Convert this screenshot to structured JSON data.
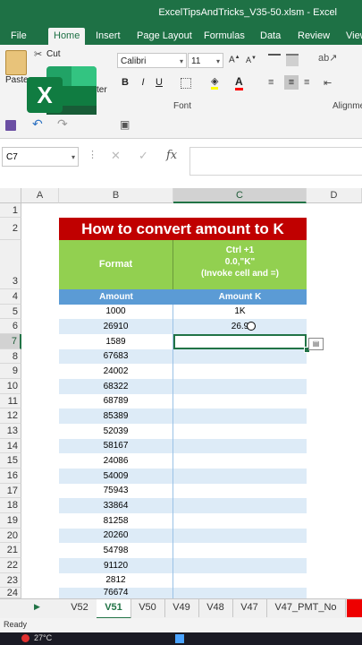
{
  "window": {
    "title": "ExcelTipsAndTricks_V35-50.xlsm - Excel"
  },
  "ribbon_tabs": [
    "File",
    "Home",
    "Insert",
    "Page Layout",
    "Formulas",
    "Data",
    "Review",
    "View"
  ],
  "ribbon": {
    "paste_label": "Paste",
    "cut_label": "Cut",
    "copy_label_partial": "ter",
    "font_name": "Calibri",
    "font_size": "11",
    "font_group_label": "Font",
    "alignment_group_label": "Alignme"
  },
  "name_box": "C7",
  "fx_symbol": "fx",
  "columns": [
    "A",
    "B",
    "C",
    "D"
  ],
  "rows": [
    "1",
    "2",
    "3",
    "4",
    "5",
    "6",
    "7",
    "8",
    "9",
    "10",
    "11",
    "12",
    "13",
    "14",
    "15",
    "16",
    "17",
    "18",
    "19",
    "20",
    "21",
    "22",
    "23",
    "24"
  ],
  "sheet": {
    "title": "How to convert amount to K",
    "format_label": "Format",
    "format_desc_line1": "Ctrl +1",
    "format_desc_line2": "0.0,\"K\"",
    "format_desc_line3": "(Invoke cell and =)",
    "col_b_header": "Amount",
    "col_c_header": "Amount K",
    "amounts": [
      "1000",
      "26910",
      "1589",
      "67683",
      "24002",
      "68322",
      "68789",
      "85389",
      "52039",
      "58167",
      "24086",
      "54009",
      "75943",
      "33864",
      "81258",
      "20260",
      "54798",
      "91120",
      "2812",
      "76674"
    ],
    "amounts_k": [
      "1K",
      "26.9"
    ]
  },
  "sheet_tabs": [
    "V52",
    "V51",
    "V50",
    "V49",
    "V48",
    "V47",
    "V47_PMT_No"
  ],
  "active_sheet": "V51",
  "status": {
    "ready": "Ready"
  },
  "taskbar": {
    "temperature": "27°C"
  },
  "colors": {
    "excel_green": "#1e7145",
    "title_red": "#c00000",
    "header_green": "#92d050",
    "header_blue": "#5b9bd5",
    "band_blue": "#ddebf7"
  }
}
